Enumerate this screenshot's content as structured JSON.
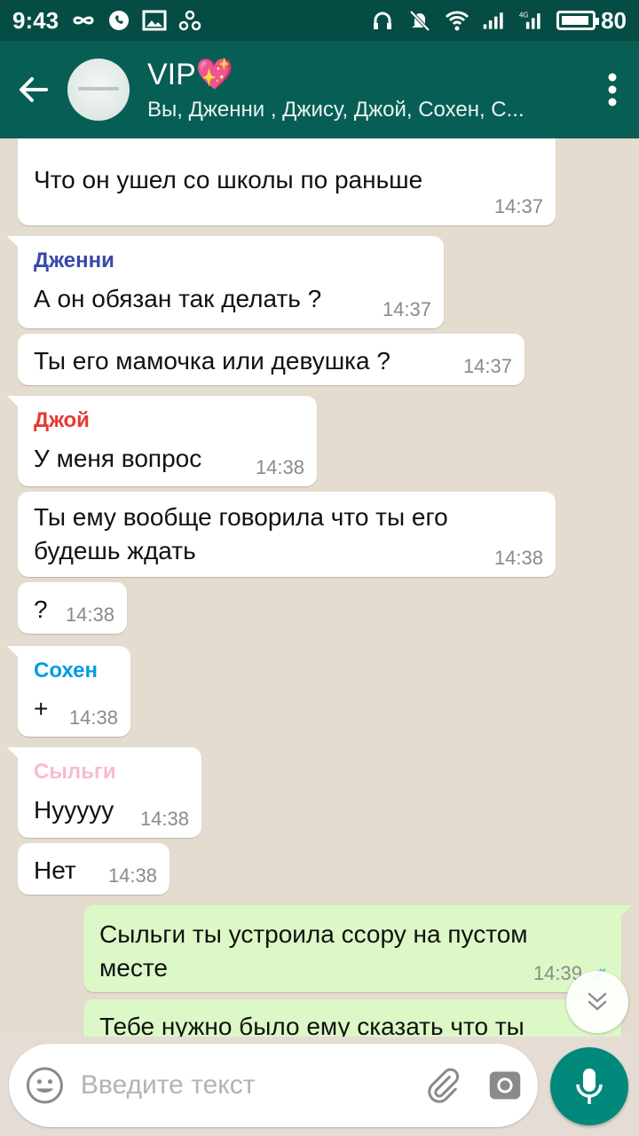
{
  "status_bar": {
    "time": "9:43",
    "battery": "80",
    "network": "4G"
  },
  "header": {
    "title": "VIP💖",
    "subtitle": "Вы, Дженни , Джису, Джой, Сохен, С..."
  },
  "messages": [
    {
      "text": "Что он ушел со школы по раньше",
      "time": "14:37"
    },
    {
      "sender": "Дженни",
      "sender_color": "#3949ab",
      "text": "А он обязан так делать ?",
      "time": "14:37"
    },
    {
      "text": "Ты его мамочка или девушка ?",
      "time": "14:37"
    },
    {
      "sender": "Джой",
      "sender_color": "#e53935",
      "text": "У меня вопрос",
      "time": "14:38"
    },
    {
      "text_line1": "Ты ему вообще говорила что ты его",
      "text_line2": "будешь ждать",
      "time": "14:38"
    },
    {
      "text": "?",
      "time": "14:38"
    },
    {
      "sender": "Сохен",
      "sender_color": "#039be5",
      "text": "+",
      "time": "14:38"
    },
    {
      "sender": "Сыльги",
      "sender_color": "#f8bbd0",
      "text": "Нууууу",
      "time": "14:38"
    },
    {
      "text": "Нет",
      "time": "14:38"
    },
    {
      "text_line1": "Сыльги ты устроила ссору на пустом",
      "text_line2": "месте",
      "time": "14:39"
    },
    {
      "text": "Тебе нужно было ему сказать что ты"
    }
  ],
  "input": {
    "placeholder": "Введите текст"
  },
  "colors": {
    "header": "#075e54",
    "statusbar": "#054d44",
    "outgoing_bubble": "#dcf8c6",
    "incoming_bubble": "#ffffff",
    "mic_button": "#00897b"
  },
  "icons": [
    "back-arrow-icon",
    "more-vert-icon",
    "emoji-icon",
    "attach-icon",
    "camera-icon",
    "mic-icon",
    "double-chevron-down-icon",
    "double-check-icon"
  ]
}
